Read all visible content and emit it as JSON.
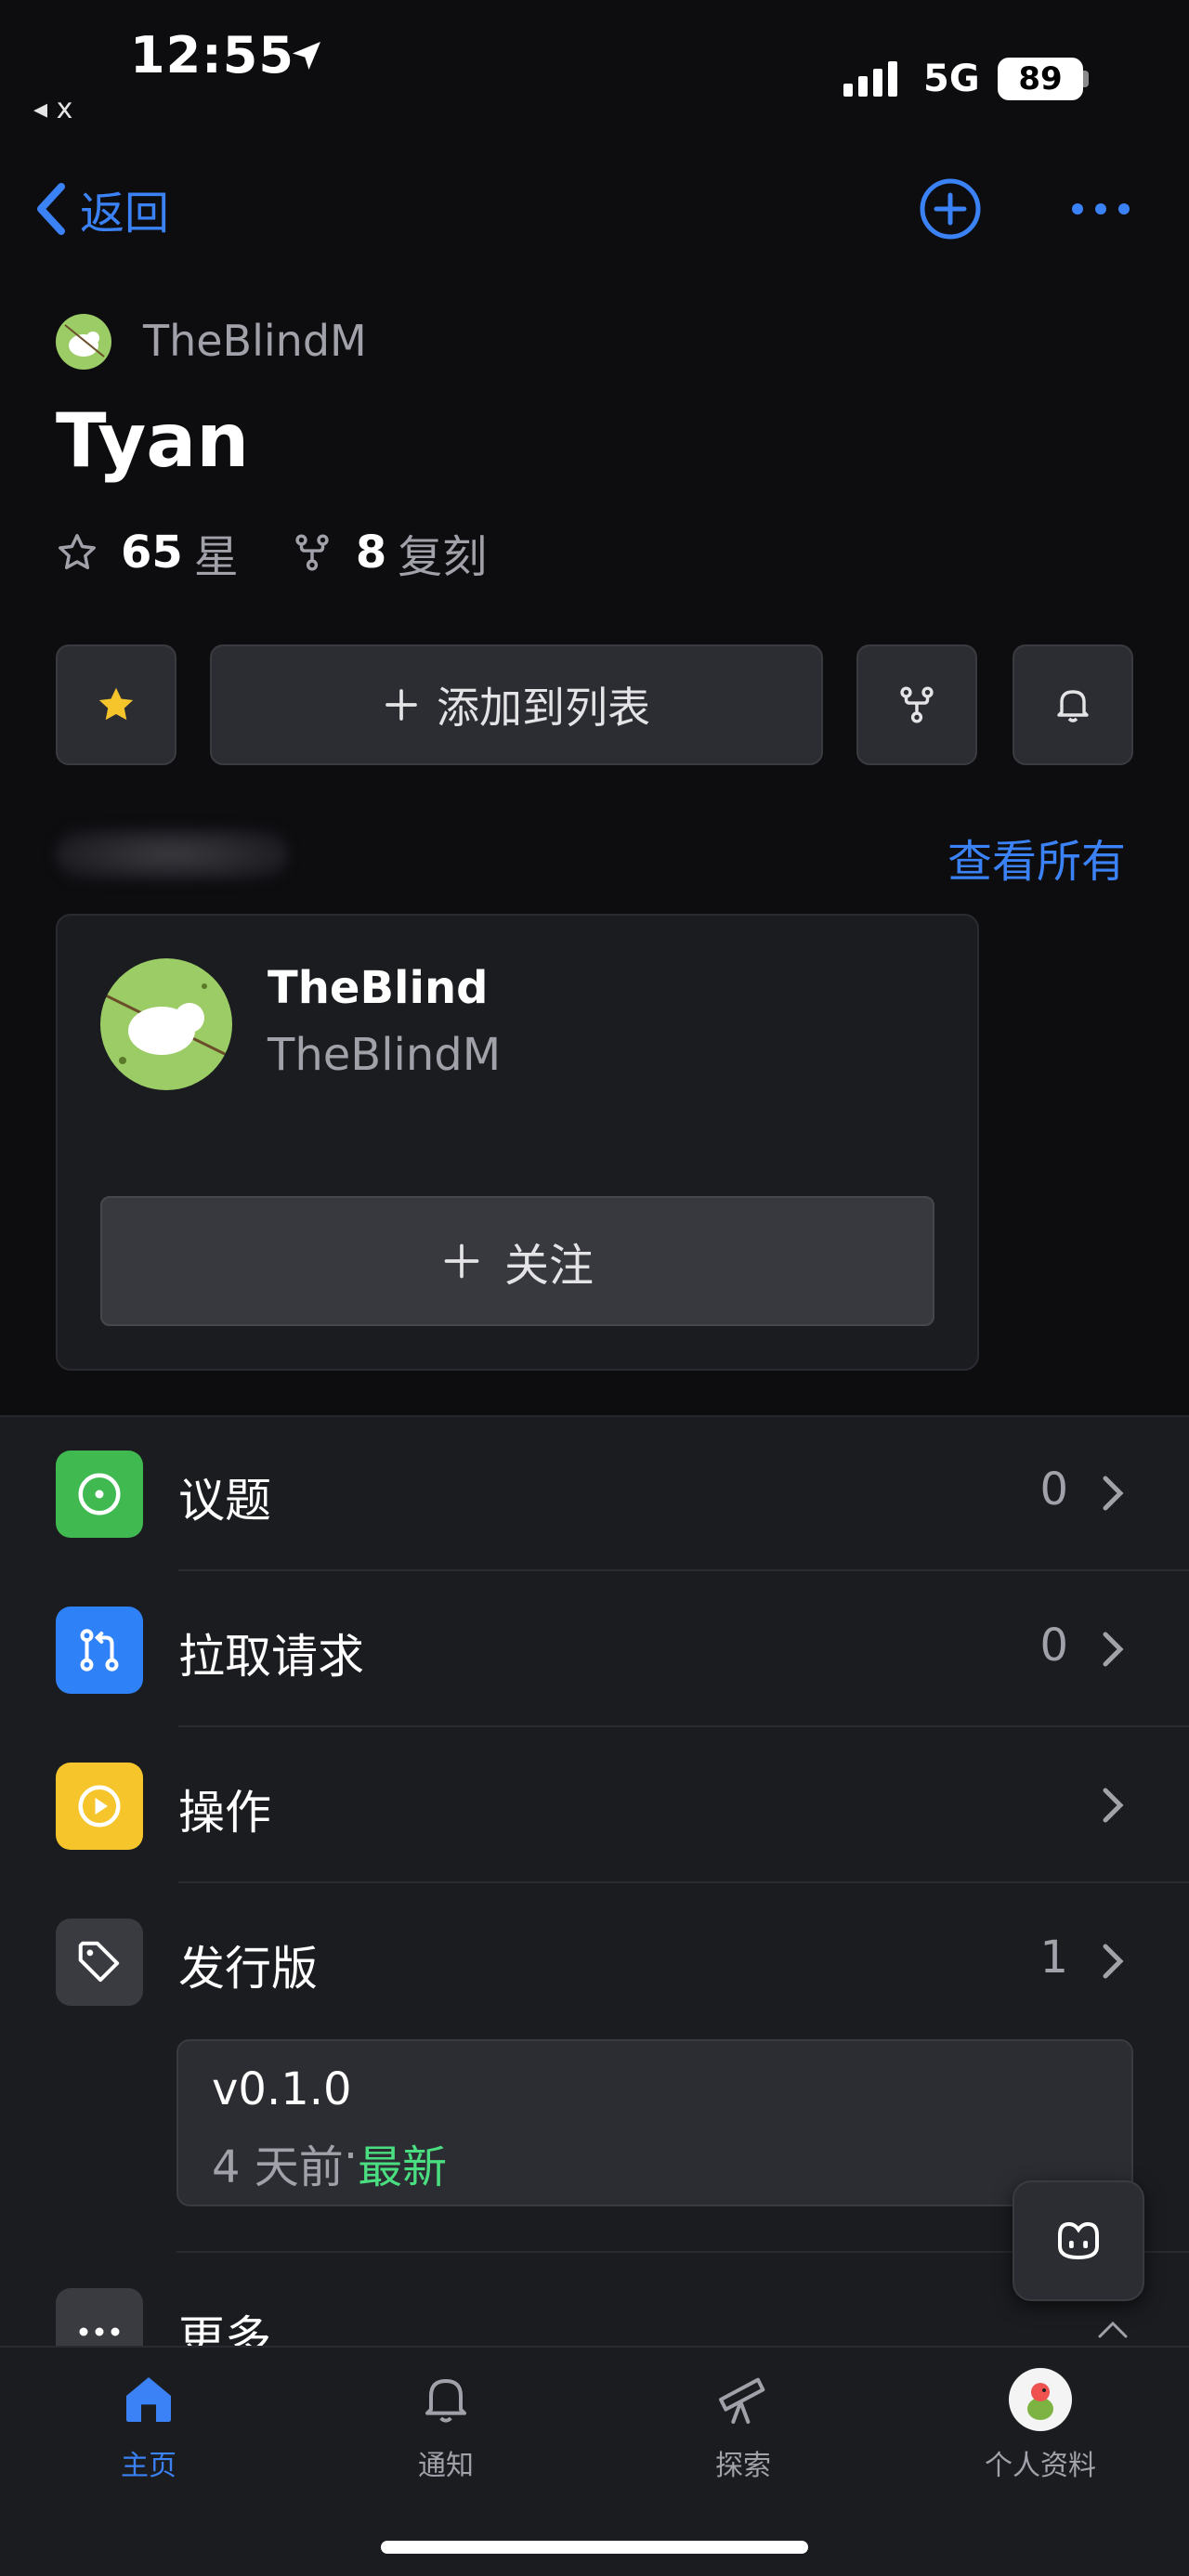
{
  "status": {
    "time": "12:55",
    "back_app": "◂ x",
    "network": "5G",
    "battery": "89"
  },
  "nav": {
    "back_label": "返回"
  },
  "repo": {
    "owner": "TheBlindM",
    "name": "Tyan",
    "stars_count": "65",
    "stars_label": "星",
    "forks_count": "8",
    "forks_label": "复刻",
    "add_to_list_label": "添加到列表"
  },
  "contributors": {
    "view_all": "查看所有",
    "card": {
      "display_name": "TheBlind",
      "handle": "TheBlindM",
      "follow_label": "关注"
    }
  },
  "list": {
    "issues": {
      "label": "议题",
      "count": "0",
      "icon": "issue-opened-icon",
      "color": "#3fb950"
    },
    "pulls": {
      "label": "拉取请求",
      "count": "0",
      "icon": "git-pull-request-icon",
      "color": "#2f81f7"
    },
    "actions": {
      "label": "操作",
      "count": "",
      "icon": "play-icon",
      "color": "#f5c52b"
    },
    "releases": {
      "label": "发行版",
      "count": "1",
      "icon": "tag-icon",
      "color": "#3a3b41"
    },
    "release_item": {
      "tag": "v0.1.0",
      "age": "4 天前",
      "dot": " · ",
      "latest": "最新"
    },
    "more": {
      "label": "更多"
    }
  },
  "tabs": [
    {
      "label": "主页",
      "icon": "home-icon"
    },
    {
      "label": "通知",
      "icon": "bell-icon"
    },
    {
      "label": "探索",
      "icon": "telescope-icon"
    },
    {
      "label": "个人资料",
      "icon": "avatar"
    }
  ],
  "colors": {
    "accent": "#3b82f6",
    "latest_green": "#4ade80",
    "star_yellow": "#f5c52b"
  }
}
